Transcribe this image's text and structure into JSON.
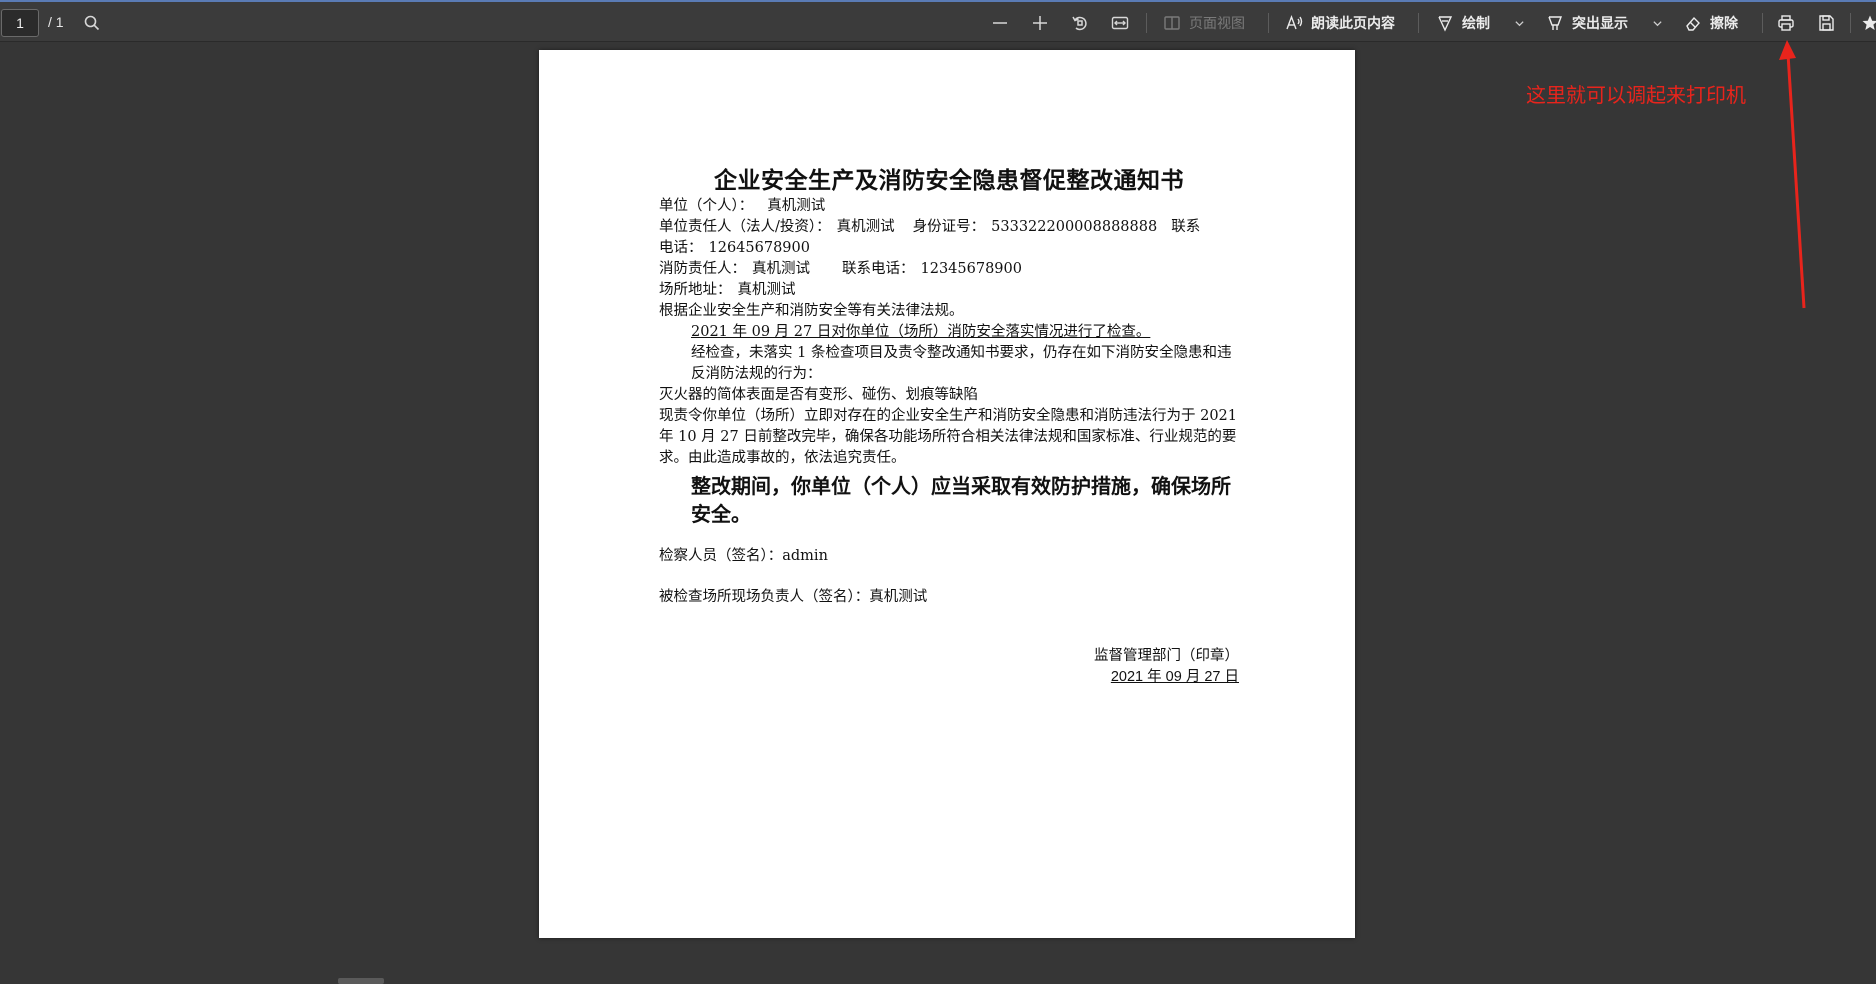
{
  "toolbar": {
    "page_current": "1",
    "page_total": "/ 1",
    "page_view_label": "页面视图",
    "read_aloud_label": "朗读此页内容",
    "draw_label": "绘制",
    "highlight_label": "突出显示",
    "erase_label": "擦除",
    "icons": [
      "search-icon",
      "zoom-out-icon",
      "zoom-in-icon",
      "rotate-icon",
      "fit-width-icon",
      "page-view-icon",
      "read-aloud-icon",
      "draw-icon",
      "highlight-icon",
      "eraser-icon",
      "print-icon",
      "save-icon",
      "favorite-icon"
    ]
  },
  "document": {
    "title": "企业安全生产及消防安全隐患督促整改通知书",
    "unit_label": "单位（个人）：",
    "unit_value": "真机测试",
    "responsible_label": "单位责任人（法人/投资）：",
    "responsible_value": "真机测试",
    "id_label": "身份证号：",
    "id_value": "533322200008888888",
    "contact_label": "联系",
    "phone_label": "电话：",
    "phone_value": "12645678900",
    "fire_resp_label": "消防责任人：",
    "fire_resp_value": "真机测试",
    "fire_phone_label": "联系电话：",
    "fire_phone_value": "12345678900",
    "address_label": "场所地址：",
    "address_value": "真机测试",
    "basis": "根据企业安全生产和消防安全等有关法律法规。",
    "inspection_line": "2021 年 09 月 27 日对你单位（场所）消防安全落实情况进行了检查。",
    "findings": "经检查，未落实 1 条检查项目及责令整改通知书要求，仍存在如下消防安全隐患和违反消防法规的行为：",
    "issue": "灭火器的简体表面是否有变形、碰伤、划痕等缺陷",
    "order": "现责令你单位（场所）立即对存在的企业安全生产和消防安全隐患和消防违法行为于 2021 年 10 月 27 日前整改完毕，确保各功能场所符合相关法律法规和国家标准、行业规范的要求。由此造成事故的，依法追究责任。",
    "notice": "整改期间，你单位（个人）应当采取有效防护措施，确保场所安全。",
    "inspector_label": "检察人员（签名）：",
    "inspector_value": "admin",
    "site_resp_label": "被检查场所现场负责人（签名）：",
    "site_resp_value": "真机测试",
    "office": "监督管理部门（印章）",
    "date": "2021 年 09 月 27 日"
  },
  "annotation": {
    "text": "这里就可以调起来打印机",
    "color": "#e8241c"
  }
}
